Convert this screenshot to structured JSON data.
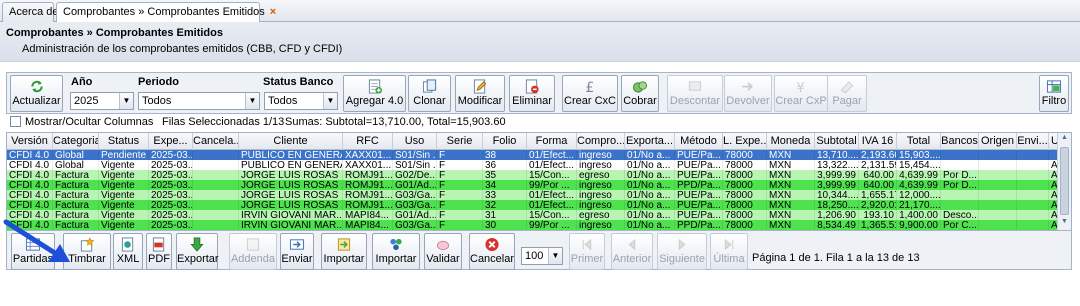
{
  "tabs": [
    {
      "label": "Acerca de"
    },
    {
      "label": "Comprobantes » Comprobantes Emitidos",
      "close": "×"
    }
  ],
  "header": {
    "title": "Comprobantes » Comprobantes Emitidos",
    "subtitle": "Administración de los comprobantes emitidos (CBB, CFD y CFDI)"
  },
  "toolbar": {
    "actualizar": "Actualizar",
    "anio_label": "Año",
    "anio_value": "2025",
    "periodo_label": "Periodo",
    "periodo_value": "Todos",
    "status_banco_label": "Status Banco",
    "status_banco_value": "Todos",
    "agregar": "Agregar 4.0",
    "clonar": "Clonar",
    "modificar": "Modificar",
    "eliminar": "Eliminar",
    "crear_cxc": "Crear CxC",
    "cobrar": "Cobrar",
    "descontar": "Descontar",
    "devolver": "Devolver",
    "crear_cxp": "Crear CxP",
    "pagar": "Pagar",
    "filtro": "Filtro"
  },
  "info": {
    "mostrar_columnas": "Mostrar/Ocultar Columnas",
    "filas": "Filas Seleccionadas 1/13",
    "sumas": "Sumas: Subtotal=13,710.00, Total=15,903.60"
  },
  "grid": {
    "columns": [
      "Versión",
      "Categoria",
      "Status",
      "Expe...",
      "Cancela...",
      "Cliente",
      "RFC",
      "Uso",
      "Serie",
      "Folio",
      "Forma",
      "Compro...",
      "Exporta...",
      "Método",
      "L. Expe...",
      "Moneda",
      "Subtotal",
      "IVA 16",
      "Total",
      "Bancos",
      "Origen",
      "Envi...",
      "UUID"
    ],
    "rows": [
      [
        "CFDI 4.0",
        "Global",
        "Pendiente",
        "2025-03...",
        "",
        "PUBLICO EN GENERAL",
        "XAXX01...",
        "S01/Sin ...",
        "F",
        "38",
        "01/Efect...",
        "ingreso",
        "01/No a...",
        "PUE/Pa...",
        "78000",
        "MXN",
        "13,710....",
        "2,193.60",
        "15,903....",
        "",
        "",
        "",
        ""
      ],
      [
        "CFDI 4.0",
        "Global",
        "Vigente",
        "2025-03...",
        "",
        "PUBLICO EN GENERAL",
        "XAXX01...",
        "S01/Sin ...",
        "F",
        "36",
        "01/Efect...",
        "ingreso",
        "01/No a...",
        "PUE/Pa...",
        "78000",
        "MXN",
        "13,322....",
        "2,131.59",
        "15,454....",
        "",
        "",
        "",
        "AAA..."
      ],
      [
        "CFDI 4.0",
        "Factura",
        "Vigente",
        "2025-03...",
        "",
        "JORGE LUIS ROSAS ...",
        "ROMJ91...",
        "G02/De...",
        "F",
        "35",
        "15/Con...",
        "egreso",
        "01/No a...",
        "PUE/Pa...",
        "78000",
        "MXN",
        "3,999.99",
        "640.00",
        "4,639.99",
        "Por D...",
        "",
        "",
        "AAA..."
      ],
      [
        "CFDI 4.0",
        "Factura",
        "Vigente",
        "2025-03...",
        "",
        "JORGE LUIS ROSAS ...",
        "ROMJ91...",
        "G01/Ad...",
        "F",
        "34",
        "99/Por ...",
        "ingreso",
        "01/No a...",
        "PPD/Pa...",
        "78000",
        "MXN",
        "3,999.99",
        "640.00",
        "4,639.99",
        "Por D...",
        "",
        "",
        "AAA..."
      ],
      [
        "CFDI 4.0",
        "Factura",
        "Vigente",
        "2025-03...",
        "",
        "JORGE LUIS ROSAS ...",
        "ROMJ91...",
        "G03/Ga...",
        "F",
        "33",
        "01/Efect...",
        "ingreso",
        "01/No a...",
        "PUE/Pa...",
        "78000",
        "MXN",
        "10,344....",
        "1,655.17",
        "12,000....",
        "",
        "",
        "",
        "AAA..."
      ],
      [
        "CFDI 4.0",
        "Factura",
        "Vigente",
        "2025-03...",
        "",
        "JORGE LUIS ROSAS ...",
        "ROMJ91...",
        "G03/Ga...",
        "F",
        "32",
        "01/Efect...",
        "ingreso",
        "01/No a...",
        "PUE/Pa...",
        "78000",
        "MXN",
        "18,250....",
        "2,920.01",
        "21,170....",
        "",
        "",
        "",
        "AAA..."
      ],
      [
        "CFDI 4.0",
        "Factura",
        "Vigente",
        "2025-03...",
        "",
        "IRVIN GIOVANI MAR...",
        "MAPI84...",
        "G01/Ad...",
        "F",
        "31",
        "15/Con...",
        "egreso",
        "01/No a...",
        "PUE/Pa...",
        "78000",
        "MXN",
        "1,206.90",
        "193.10",
        "1,400.00",
        "Desco...",
        "",
        "",
        "AAA..."
      ],
      [
        "CFDI 4.0",
        "Factura",
        "Vigente",
        "2025-03...",
        "",
        "IRVIN GIOVANI MAR...",
        "MAPI84...",
        "G03/Ga...",
        "F",
        "30",
        "99/Por ...",
        "ingreso",
        "01/No a...",
        "PPD/Pa...",
        "78000",
        "MXN",
        "8,534.49",
        "1,365.51",
        "9,900.00",
        "Por C...",
        "",
        "",
        "AAA..."
      ]
    ],
    "row_colors": [
      "#3a73c9",
      "#ffffff",
      "#b8f5b3",
      "#4fe24f",
      "#b8f5b3",
      "#4fe24f",
      "#b8f5b3",
      "#4fe24f"
    ]
  },
  "bottombar": {
    "partidas": "Partidas",
    "timbrar": "Timbrar",
    "xml": "XML",
    "pdf": "PDF",
    "exportar": "Exportar",
    "addenda": "Addenda",
    "enviar": "Enviar",
    "importar1": "Importar",
    "importar2": "Importar",
    "validar": "Validar",
    "cancelar": "Cancelar",
    "page_size": "100",
    "primer": "Primer",
    "anterior": "Anterior",
    "siguiente": "Siguiente",
    "ultima": "Última",
    "pagina_info": "Página 1 de 1. Fila 1 a la 13 de 13"
  },
  "colors": {
    "selected_row": "#3a73c9",
    "green_light": "#b8f5b3",
    "green_strong": "#4fe24f",
    "annotation_arrow": "#1d4fd8"
  }
}
